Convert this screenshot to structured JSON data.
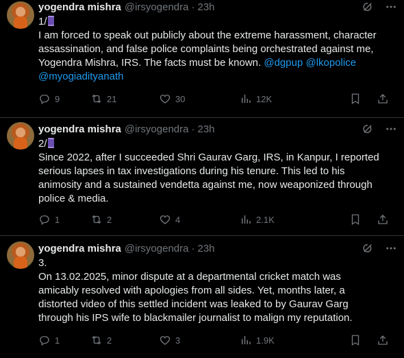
{
  "tweets": [
    {
      "name": "yogendra mishra",
      "handle": "@irsyogendra",
      "sep": "·",
      "time": "23h",
      "lines": [
        "1/",
        "I am forced to speak out publicly about the extreme harassment, character",
        "assassination, and false police complaints being orchestrated against me,",
        "Yogendra Mishra, IRS. The facts must be known. ",
        "@myogiadityanath"
      ],
      "mentions": [
        "@dgpup",
        "@lkopolice"
      ],
      "replies": "9",
      "reposts": "21",
      "likes": "30",
      "views": "12K"
    },
    {
      "name": "yogendra mishra",
      "handle": "@irsyogendra",
      "sep": "·",
      "time": "23h",
      "lines": [
        "2/",
        "Since 2022, after I succeeded Shri Gaurav Garg, IRS, in Kanpur, I reported",
        "serious lapses in tax investigations during his tenure. This led to his",
        "animosity and a sustained vendetta against me, now weaponized through",
        "police & media."
      ],
      "replies": "1",
      "reposts": "2",
      "likes": "4",
      "views": "2.1K"
    },
    {
      "name": "yogendra mishra",
      "handle": "@irsyogendra",
      "sep": "·",
      "time": "23h",
      "lines": [
        "3.",
        "On 13.02.2025, minor dispute at a departmental cricket match was",
        "amicably resolved with apologies from all sides. Yet, months later, a",
        "distorted video of this settled incident was leaked to by Gaurav Garg",
        "through his IPS wife to blackmailer journalist to malign my reputation."
      ],
      "replies": "1",
      "reposts": "2",
      "likes": "3",
      "views": "1.9K"
    }
  ],
  "icons": {
    "avatar": "profile-photo",
    "grok": "grok-icon",
    "more": "more-icon",
    "reply": "reply-icon",
    "repost": "repost-icon",
    "like": "heart-icon",
    "views": "views-icon",
    "bookmark": "bookmark-icon",
    "share": "share-icon",
    "thread_marker": "spool-of-thread-emoji"
  },
  "colors": {
    "background": "#000000",
    "text": "#e7e9ea",
    "muted": "#71767b",
    "link": "#1d9bf0",
    "divider": "#2f3336"
  }
}
